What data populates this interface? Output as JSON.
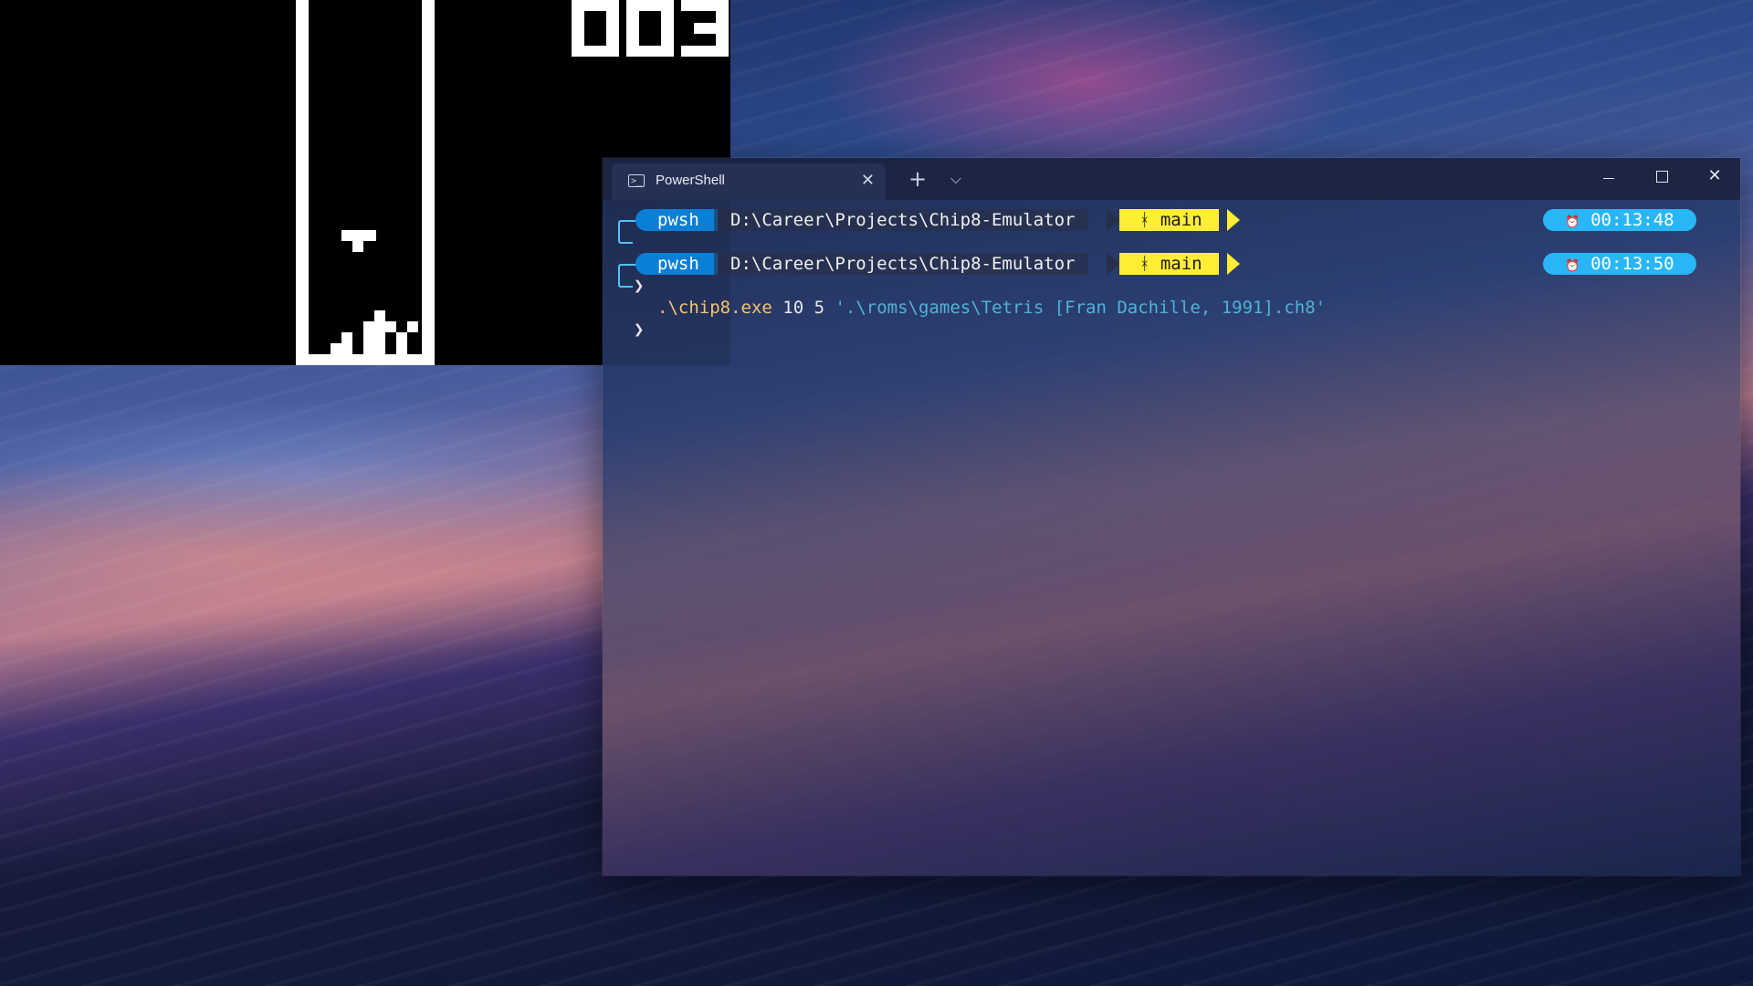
{
  "game": {
    "score": "003"
  },
  "terminal": {
    "tab_title": "PowerShell",
    "tab_icon": "powershell-icon",
    "new_tab_symbol": "+",
    "dropdown_symbol": "⌵",
    "close_symbol": "✕",
    "prompts": [
      {
        "shell": "pwsh",
        "path": "D:\\Career\\Projects\\Chip8-Emulator",
        "git_branch": "main",
        "git_icon": "git-branch-icon",
        "time": "00:13:48",
        "command_exe": ".\\chip8.exe",
        "command_args": " 10 5 ",
        "command_string": "'.\\roms\\games\\Tetris [Fran Dachille, 1991].ch8'"
      },
      {
        "shell": "pwsh",
        "path": "D:\\Career\\Projects\\Chip8-Emulator",
        "git_branch": "main",
        "git_icon": "git-branch-icon",
        "time": "00:13:50",
        "command_exe": "",
        "command_args": "",
        "command_string": ""
      }
    ],
    "prompt_symbol": "❯",
    "git_glyph": "ᚼ",
    "time_glyph": "⏰"
  },
  "colors": {
    "pwsh_segment": "#0a7fd6",
    "git_segment": "#ffee33",
    "time_segment": "#28b6f6",
    "exe_text": "#f5c46b",
    "string_text": "#4fb3d9"
  }
}
